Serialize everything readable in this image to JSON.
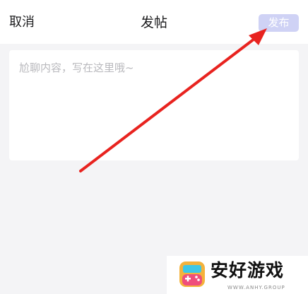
{
  "header": {
    "cancel_label": "取消",
    "title": "发帖",
    "publish_label": "发布"
  },
  "composer": {
    "placeholder": "尬聊内容，写在这里哦~",
    "value": ""
  },
  "watermark": {
    "brand_name": "安好游戏",
    "brand_sub": "WWW.ANHY.GROUP"
  },
  "colors": {
    "background": "#f4f4f6",
    "surface": "#ffffff",
    "publish_disabled": "#cfd2f5",
    "annotation_arrow": "#e8231f",
    "placeholder_text": "#b9b9bd"
  },
  "icons": {
    "watermark_logo": "game-controller-icon",
    "annotation": "arrow-annotation-icon"
  }
}
